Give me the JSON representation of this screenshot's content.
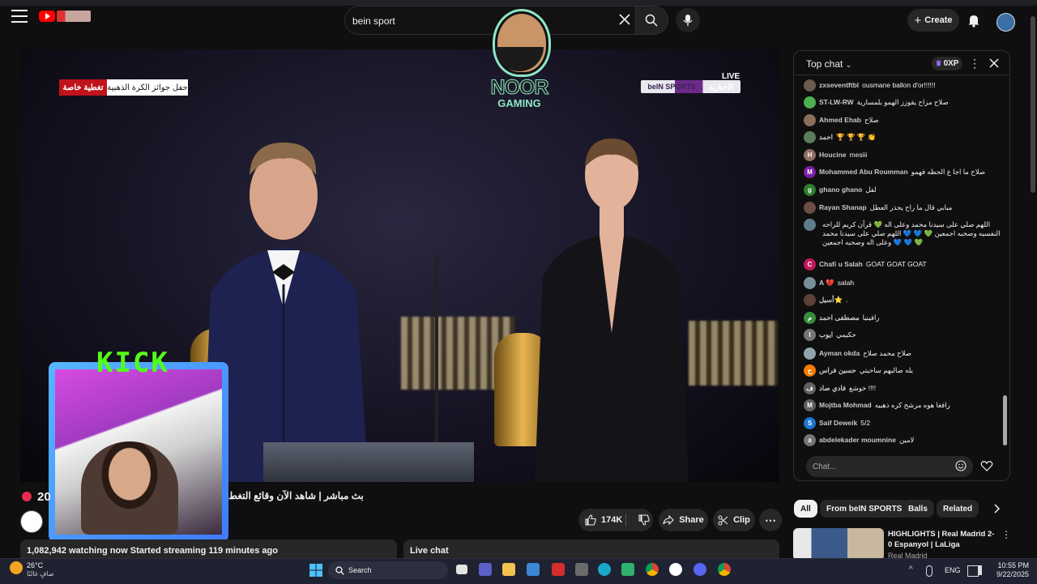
{
  "header": {
    "search_value": "bein sport",
    "create_label": "Create"
  },
  "video": {
    "special_coverage": "تغطية خاصة",
    "ceremony_label": "حفل جوائز الكرة الذهبية",
    "live_tag": "LIVE",
    "channel_logo_en": "beIN SPORTS",
    "channel_logo_ar": "الإخبارية",
    "overlay_logo_name": "NOOR",
    "overlay_logo_sub": "GAMING",
    "kick_label": "KICK"
  },
  "info": {
    "viewer_count_partial": "20",
    "title": "بث مباشر | شاهد الآن وقائع التغط",
    "like_count": "174K",
    "share_label": "Share",
    "clip_label": "Clip",
    "stats": "1,082,942 watching now  Started streaming 119 minutes ago",
    "live_chat_label": "Live chat"
  },
  "chat": {
    "header_label": "Top chat",
    "xp_label": "0XP",
    "input_placeholder": "Chat...",
    "messages": [
      {
        "user": "zxseventftbl",
        "text": "ousmane ballon d'or!!!!!!",
        "avatar_color": "#6b5b4b",
        "initial": ""
      },
      {
        "user": "ST-LW-RW",
        "text": "صلاح مزاح يقوزز الهمو بلمسارية",
        "avatar_color": "#4caf50",
        "initial": ""
      },
      {
        "user": "Ahmed Ehab",
        "text": "صلاح",
        "avatar_color": "#8a6d5a",
        "initial": ""
      },
      {
        "user": "احمد",
        "text": "🏆 🏆 🏆 👏",
        "avatar_color": "#5a7d5e",
        "initial": ""
      },
      {
        "user": "Houcine",
        "text": "mesiii",
        "avatar_color": "#8d6e63",
        "initial": "H"
      },
      {
        "user": "Mohammed Abu Roumman",
        "text": "صلاح ما اجا ع الحظه فهمو",
        "avatar_color": "#7b1fa2",
        "initial": "M"
      },
      {
        "user": "ghano ghano",
        "text": "لفل",
        "avatar_color": "#2e7d32",
        "initial": "g"
      },
      {
        "user": "Rayan Shanap",
        "text": "مبابي قال ما راح يحذر العطل",
        "avatar_color": "#6d4c41",
        "initial": ""
      },
      {
        "user": "",
        "text": "اللهم صلي على سيدنا محمد وعلى اله 💚 قرآن كريم للراحه النفسيه وصحبه اجمعين 💚 💙 💙 اللهم صلي على سيدنا محمد وعلى اله وصحبه اجمعين 💙 💙 💚",
        "avatar_color": "#607d8b",
        "initial": ""
      },
      {
        "user": "Chafi u Salah",
        "text": "GOAT GOAT GOAT",
        "avatar_color": "#c2185b",
        "initial": "C"
      },
      {
        "user": "A 💔",
        "text": "salah",
        "avatar_color": "#78909c",
        "initial": ""
      },
      {
        "user": "أسيل⭐",
        "text": ".",
        "avatar_color": "#5d4037",
        "initial": ""
      },
      {
        "user": "مصطفى احمد",
        "text": "رافينيا",
        "avatar_color": "#388e3c",
        "initial": "م"
      },
      {
        "user": "ايوب",
        "text": "حكيمي",
        "avatar_color": "#757575",
        "initial": "I"
      },
      {
        "user": "Ayman okda",
        "text": "صلاح محمد صلاح",
        "avatar_color": "#90a4ae",
        "initial": ""
      },
      {
        "user": "حسين فراس",
        "text": "يله صالبهم ساحيتي",
        "avatar_color": "#f57c00",
        "initial": "ح"
      },
      {
        "user": "فادي صاد",
        "text": "خوشع !!!!",
        "avatar_color": "#616161",
        "initial": "ف"
      },
      {
        "user": "Mojtba Mohmad",
        "text": "رافغا هوه مرشح كره ذهبيه",
        "avatar_color": "#616161",
        "initial": "M"
      },
      {
        "user": "Saif Deweik",
        "text": "5/2",
        "avatar_color": "#1976d2",
        "initial": "S"
      },
      {
        "user": "abdelekader moumnine",
        "text": "لامين",
        "avatar_color": "#757575",
        "initial": "a"
      }
    ]
  },
  "filters": [
    "All",
    "From beIN SPORTS",
    "Balls",
    "Related"
  ],
  "recommended": {
    "title": "HIGHLIGHTS | Real Madrid 2-0 Espanyol | LaLiga",
    "channel": "Real Madrid"
  },
  "taskbar": {
    "temp": "26°C",
    "weather": "صافٍ غالبًا",
    "search_label": "Search",
    "lang": "ENG",
    "time": "10:55 PM",
    "date": "9/22/2025"
  }
}
